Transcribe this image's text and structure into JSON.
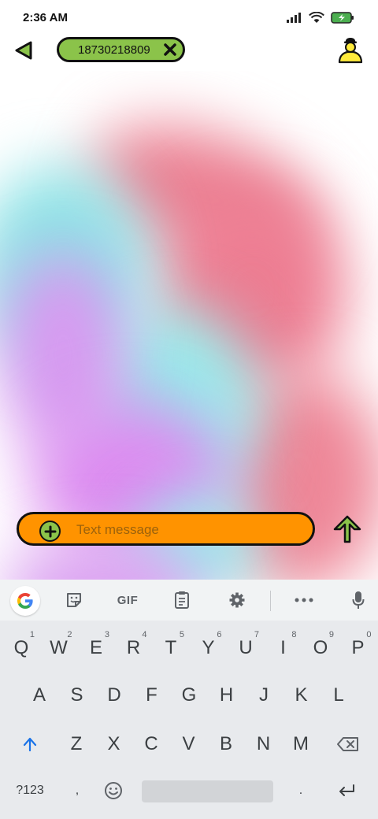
{
  "status": {
    "time": "2:36 AM"
  },
  "header": {
    "phone_number": "18730218809"
  },
  "compose": {
    "placeholder": "Text message"
  },
  "keyboard": {
    "toolbar": {
      "gif_label": "GIF"
    },
    "row1": [
      {
        "key": "Q",
        "hint": "1"
      },
      {
        "key": "W",
        "hint": "2"
      },
      {
        "key": "E",
        "hint": "3"
      },
      {
        "key": "R",
        "hint": "4"
      },
      {
        "key": "T",
        "hint": "5"
      },
      {
        "key": "Y",
        "hint": "6"
      },
      {
        "key": "U",
        "hint": "7"
      },
      {
        "key": "I",
        "hint": "8"
      },
      {
        "key": "O",
        "hint": "9"
      },
      {
        "key": "P",
        "hint": "0"
      }
    ],
    "row2": [
      "A",
      "S",
      "D",
      "F",
      "G",
      "H",
      "J",
      "K",
      "L"
    ],
    "row3": [
      "Z",
      "X",
      "C",
      "V",
      "B",
      "N",
      "M"
    ],
    "symbols_label": "?123",
    "comma": ",",
    "period": "."
  }
}
